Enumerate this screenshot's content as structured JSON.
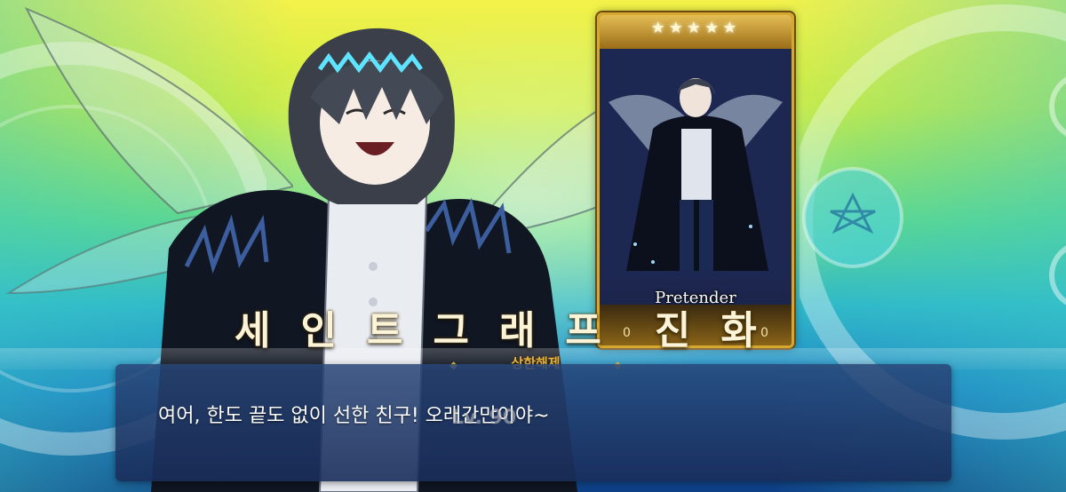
{
  "card": {
    "stars": "★★★★★",
    "class_label": "Pretender",
    "digits_left": "0",
    "digits_right": "0",
    "colors": {
      "frame": "#d7a830"
    }
  },
  "title": {
    "chars": [
      "세",
      "인",
      "트",
      "그",
      "래",
      "프",
      "진",
      "화"
    ]
  },
  "subbanner": {
    "text": "상한해제",
    "left_ornament": "◆",
    "right_ornament": "◆"
  },
  "level_ghost": "Lv. 90",
  "dialog": {
    "text": "여어, 한도 끝도 없이 선한 친구! 오래간만이야~"
  },
  "colors": {
    "background_top": "#f4f24a",
    "background_bottom": "#0f3f86",
    "dialog_bg": "#28467a",
    "title_text": "#fbf4d8",
    "banner_gold": "#e8b640"
  }
}
